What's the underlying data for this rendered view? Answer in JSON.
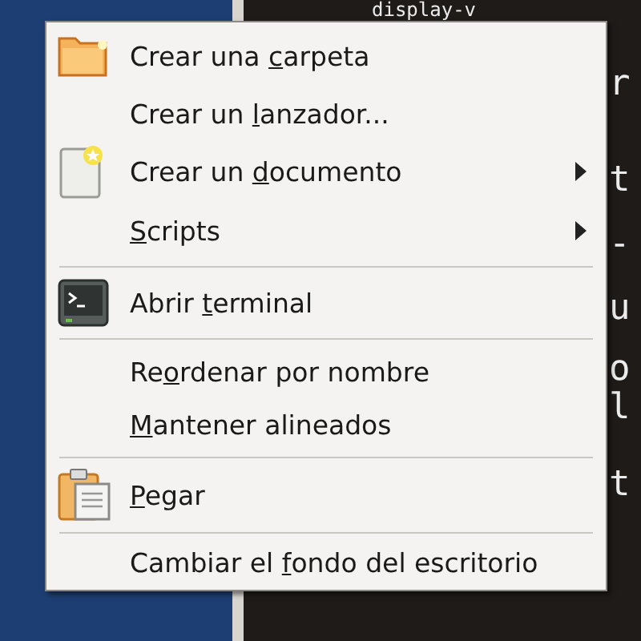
{
  "terminal": {
    "lines": [
      "display-v",
      "r",
      "t",
      "-",
      "u",
      "o",
      "l",
      "t"
    ]
  },
  "context_menu": {
    "items": [
      {
        "kind": "item",
        "label": {
          "before": "Crear una ",
          "key": "c",
          "after": "arpeta"
        },
        "submenu": false
      },
      {
        "kind": "item",
        "label": {
          "before": "Crear un ",
          "key": "l",
          "after": "anzador..."
        },
        "submenu": false
      },
      {
        "kind": "item",
        "label": {
          "before": "Crear un ",
          "key": "d",
          "after": "ocumento"
        },
        "submenu": true
      },
      {
        "kind": "item",
        "label": {
          "key": "S",
          "after": "cripts"
        },
        "submenu": true
      },
      {
        "kind": "separator"
      },
      {
        "kind": "item",
        "label": {
          "before": "Abrir ",
          "key": "t",
          "after": "erminal"
        },
        "submenu": false
      },
      {
        "kind": "separator"
      },
      {
        "kind": "item",
        "label": {
          "before": "Re",
          "key": "o",
          "after": "rdenar por nombre"
        },
        "submenu": false
      },
      {
        "kind": "item",
        "label": {
          "key": "M",
          "after": "antener alineados"
        },
        "submenu": false
      },
      {
        "kind": "separator"
      },
      {
        "kind": "item",
        "label": {
          "key": "P",
          "after": "egar"
        },
        "submenu": false
      },
      {
        "kind": "separator"
      },
      {
        "kind": "item",
        "label": {
          "before": "Cambiar el ",
          "key": "f",
          "after": "ondo del escritorio"
        },
        "submenu": false
      }
    ]
  }
}
